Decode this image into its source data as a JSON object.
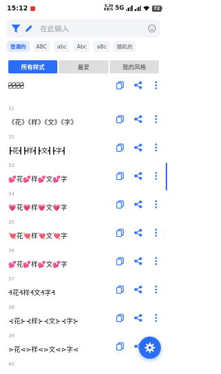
{
  "status": {
    "time": "15:12",
    "net_speed_value": "0.34",
    "net_speed_unit": "KB/S",
    "network": "5G",
    "battery": "72"
  },
  "search": {
    "placeholder": "在此输入"
  },
  "chips": [
    "普通的",
    "ABC",
    "abc",
    "Abc",
    "aBc",
    "随机的"
  ],
  "tabs": [
    "所有样式",
    "最爱",
    "我的风格"
  ],
  "rows": [
    {
      "num": "",
      "text": "花̶̷̷样̶̷̷文̶̷̷字̶̷̷"
    },
    {
      "num": "31",
      "text": "《花》《样》《文》《字》"
    },
    {
      "num": "32",
      "text": "┣花┫┣样┫┣文┫┣字┫"
    },
    {
      "num": "33",
      "text": "💕花💕样💕文💕字"
    },
    {
      "num": "34",
      "text": "💗花💗样💗文💗字"
    },
    {
      "num": "35",
      "text": "💘花💘样💘文💘字"
    },
    {
      "num": "36",
      "text": "💕花💕样💕文💕字"
    },
    {
      "num": "37",
      "text": "₰花₰样₰文₰字₰"
    },
    {
      "num": "38",
      "text": "⊰花⊱⊰样⊱⊰文⊱⊰字⊱"
    },
    {
      "num": "39",
      "text": "⋗花⋖⋗样⋖⋗文⋖⋗字⋖"
    },
    {
      "num": "40",
      "text": ""
    }
  ],
  "colors": {
    "accent": "#2a6ef5",
    "chip_active_bg": "#e3ecff",
    "tab_inactive_bg": "#dedede",
    "search_bg": "#f2f4f8"
  },
  "icons": {
    "search_filter": "filter-funnel-icon",
    "edit": "pencil-icon",
    "emoji": "smiley-icon",
    "copy": "copy-icon",
    "share": "share-icon",
    "more": "more-vertical-icon",
    "fab": "gear-icon"
  }
}
